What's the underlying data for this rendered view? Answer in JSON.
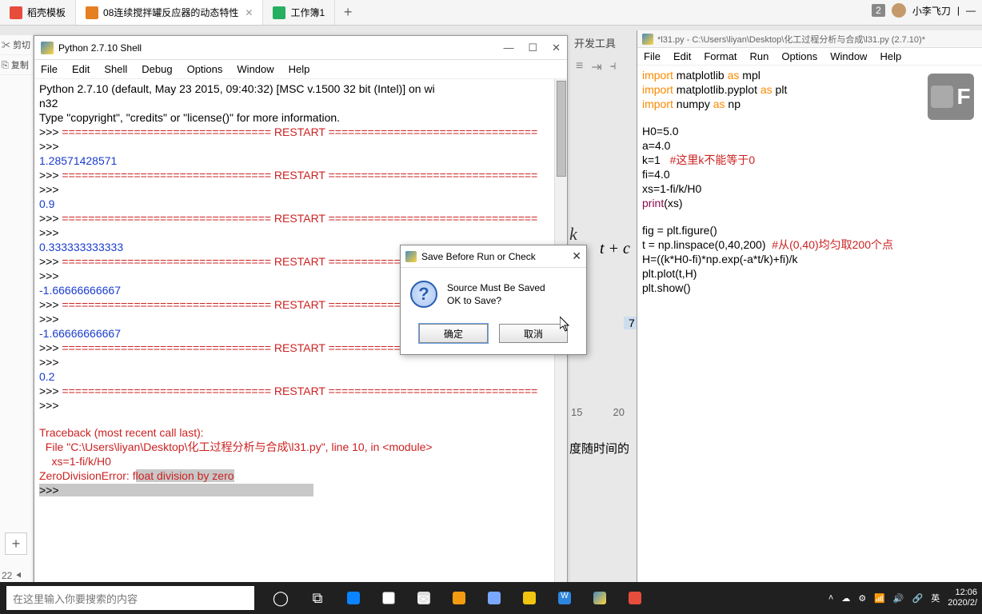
{
  "top_tabs": {
    "tab1": "稻壳模板",
    "tab2": "08连续搅拌罐反应器的动态特性",
    "tab3": "工作簿1",
    "user": "小李飞刀",
    "badge": "2"
  },
  "left": {
    "item1": "剪切",
    "item2": "复制",
    "num": "22"
  },
  "shell": {
    "title": "Python 2.7.10 Shell",
    "menus": [
      "File",
      "Edit",
      "Shell",
      "Debug",
      "Options",
      "Window",
      "Help"
    ],
    "line_header1": "Python 2.7.10 (default, May 23 2015, 09:40:32) [MSC v.1500 32 bit (Intel)] on wi",
    "line_header2": "n32",
    "line_type": "Type \"copyright\", \"credits\" or \"license()\" for more information.",
    "restart": "================================ RESTART ================================",
    "prompt": ">>> ",
    "val1": "1.28571428571",
    "val2": "0.9",
    "val3": "0.333333333333",
    "val4": "-1.66666666667",
    "val5": "-1.66666666667",
    "val6": "0.2",
    "tb1": "Traceback (most recent call last):",
    "tb2": "  File \"C:\\Users\\liyan\\Desktop\\化工过程分析与合成\\l31.py\", line 10, in <module>",
    "tb3": "    xs=1-fi/k/H0",
    "tb4_a": "ZeroDivisionError: f",
    "tb4_b": "loat division by zero"
  },
  "editor": {
    "title": "*l31.py - C:\\Users\\liyan\\Desktop\\化工过程分析与合成\\l31.py (2.7.10)*",
    "menus": [
      "File",
      "Edit",
      "Format",
      "Run",
      "Options",
      "Window",
      "Help"
    ],
    "code": {
      "l1a": "import",
      "l1b": " matplotlib ",
      "l1c": "as",
      "l1d": " mpl",
      "l2a": "import",
      "l2b": " matplotlib.pyplot ",
      "l2c": "as",
      "l2d": " plt",
      "l3a": "import",
      "l3b": " numpy ",
      "l3c": "as",
      "l3d": " np",
      "l5": "H0=5.0",
      "l6": "a=4.0",
      "l7a": "k=1   ",
      "l7b": "#这里k不能等于0",
      "l8": "fi=4.0",
      "l9": "xs=1-fi/k/H0",
      "l10a": "print",
      "l10b": "(xs)",
      "l12": "fig = plt.figure()",
      "l13a": "t = np.linspace(0,40,200)  ",
      "l13b": "#从(0,40)均匀取200个点",
      "l14": "H=((k*H0-fi)*np.exp(-a*t/k)+fi)/k",
      "l15": "plt.plot(t,H)",
      "l16": "plt.show()"
    },
    "badge": "F"
  },
  "bg": {
    "k": "k",
    "tc": "t + c",
    "seven": "7",
    "ax1": "15",
    "ax2": "20",
    "cn": "度随时间的"
  },
  "modal": {
    "title": "Save Before Run or Check",
    "msg1": "Source Must Be Saved",
    "msg2": "OK to Save?",
    "ok": "确定",
    "cancel": "取消"
  },
  "taskbar": {
    "search_placeholder": "在这里输入你要搜索的内容",
    "time": "12:06",
    "date": "2020/2/",
    "ime": "英"
  },
  "ribbon_hint": "开发工具"
}
